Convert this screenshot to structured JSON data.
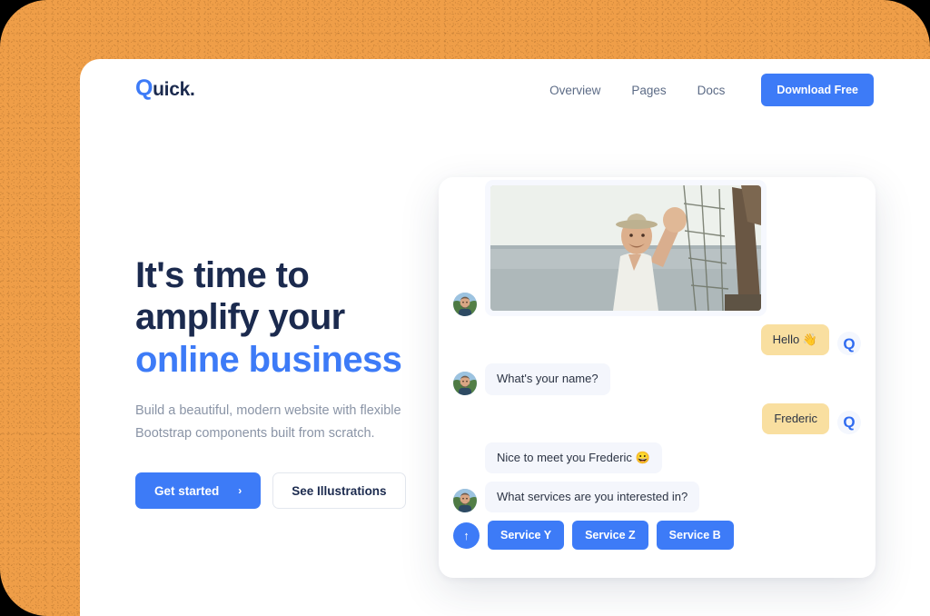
{
  "theme": {
    "backdrop_color": "#EF9E48",
    "accent_color": "#3D7BF7",
    "heading_color": "#1B2A4E",
    "bubble_me_color": "#F9DFA0",
    "bubble_them_color": "#F4F6FC"
  },
  "navbar": {
    "brand_q": "Q",
    "brand_rest": "uick.",
    "links": [
      {
        "label": "Overview"
      },
      {
        "label": "Pages"
      },
      {
        "label": "Docs"
      }
    ],
    "cta_label": "Download Free"
  },
  "hero": {
    "heading_line1": "It's time to",
    "heading_line2": "amplify your",
    "heading_accent": "online business",
    "subtitle": "Build a beautiful, modern website with flexible Bootstrap components built from scratch.",
    "primary_button": "Get started",
    "primary_button_icon": "chevron-right-icon",
    "primary_button_chevron": "›",
    "secondary_button": "See Illustrations"
  },
  "chat": {
    "skeleton_placeholder": "",
    "media_alt": "fisherman-waving-photo",
    "messages": [
      {
        "from": "them",
        "type": "media",
        "text": ""
      },
      {
        "from": "me",
        "type": "text",
        "text": "Hello 👋"
      },
      {
        "from": "them",
        "type": "text",
        "text": "What's your name?"
      },
      {
        "from": "me",
        "type": "text",
        "text": "Frederic"
      },
      {
        "from": "them",
        "type": "text",
        "text": "Nice to meet you Frederic 😀"
      },
      {
        "from": "them",
        "type": "text",
        "text": "What services are you interested in?"
      }
    ],
    "send_icon": "arrow-up-icon",
    "send_glyph": "↑",
    "quick_replies": [
      {
        "label": "Service Y"
      },
      {
        "label": "Service Z"
      },
      {
        "label": "Service B"
      }
    ],
    "agent_avatar_name": "agent-avatar",
    "user_avatar_letter": "Q"
  }
}
